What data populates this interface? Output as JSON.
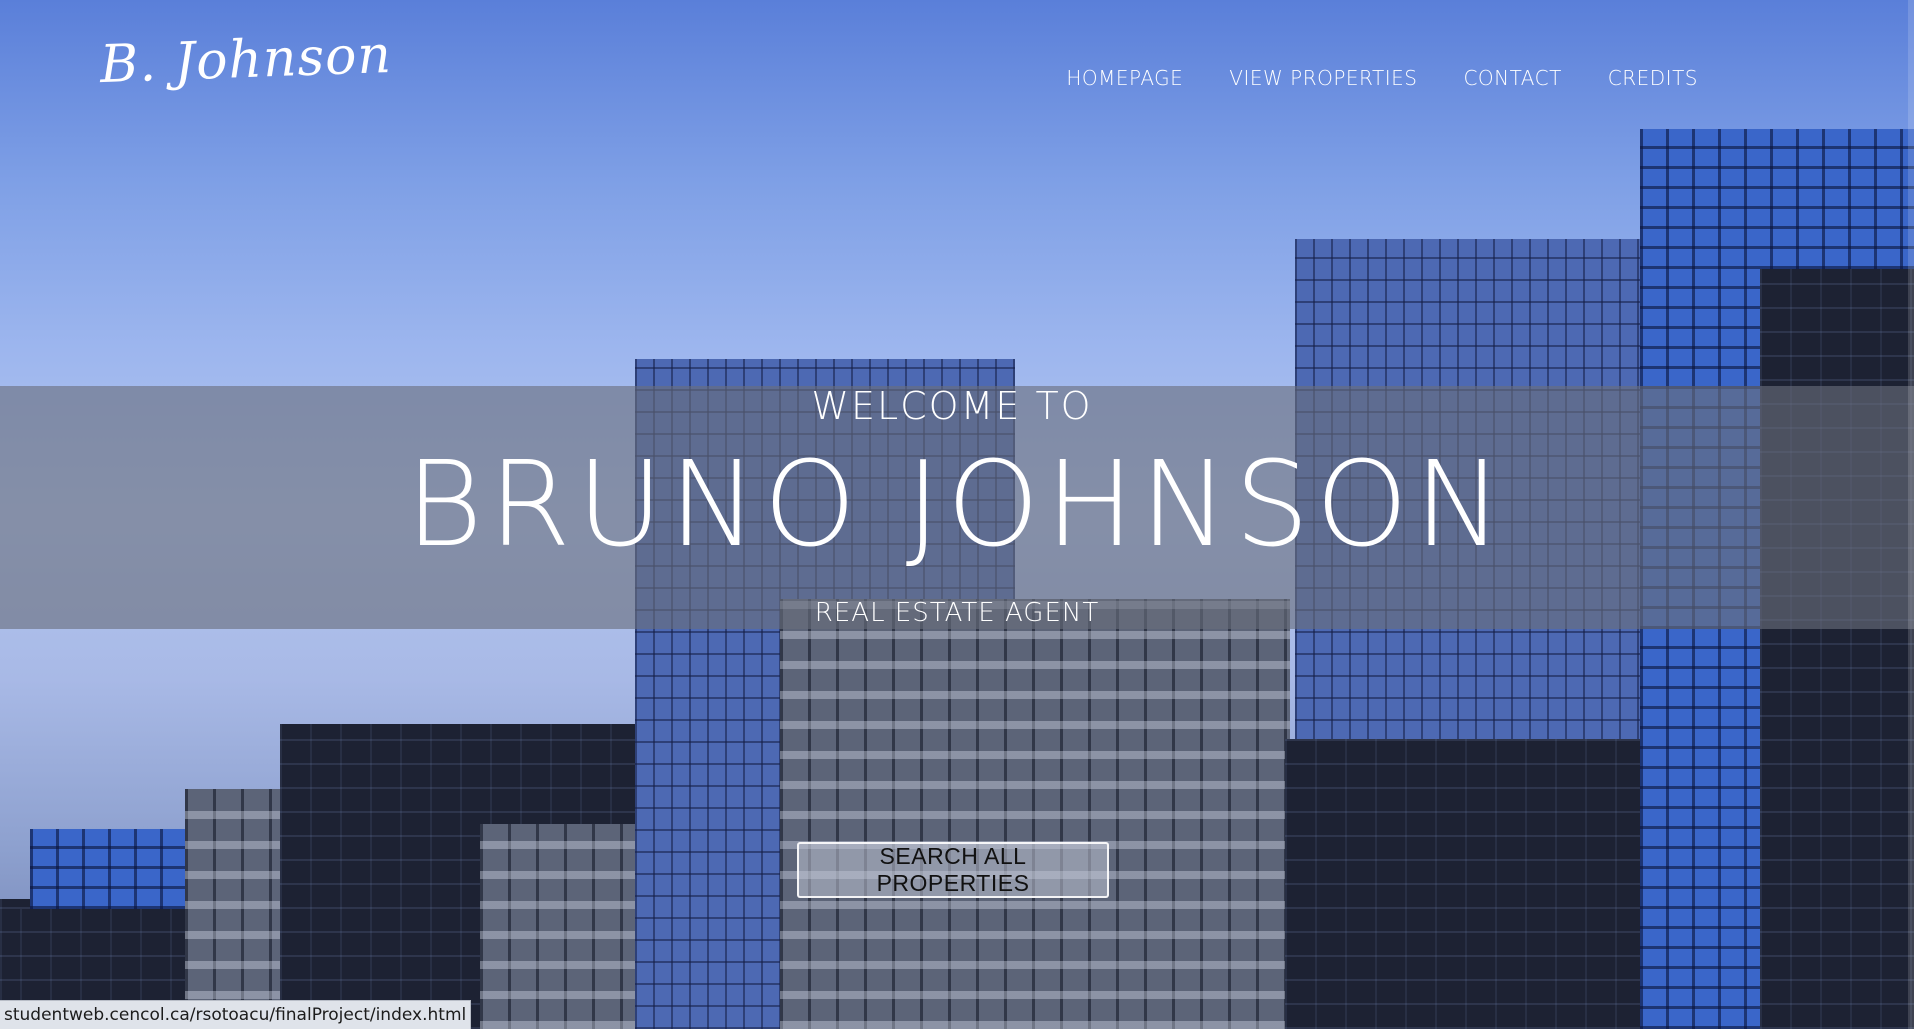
{
  "header": {
    "logo": "B. Johnson",
    "nav": [
      {
        "label": "HOMEPAGE"
      },
      {
        "label": "VIEW PROPERTIES"
      },
      {
        "label": "CONTACT"
      },
      {
        "label": "CREDITS"
      }
    ]
  },
  "hero": {
    "welcome": "WELCOME TO",
    "name": "BRUNO JOHNSON",
    "role": "REAL ESTATE AGENT",
    "cta_label": "SEARCH ALL PROPERTIES"
  },
  "status_bar": {
    "url": "studentweb.cencol.ca/rsotoacu/finalProject/index.html"
  },
  "colors": {
    "sky_top": "#5a7fd9",
    "band_overlay": "#696e7d",
    "text": "#ffffff"
  }
}
